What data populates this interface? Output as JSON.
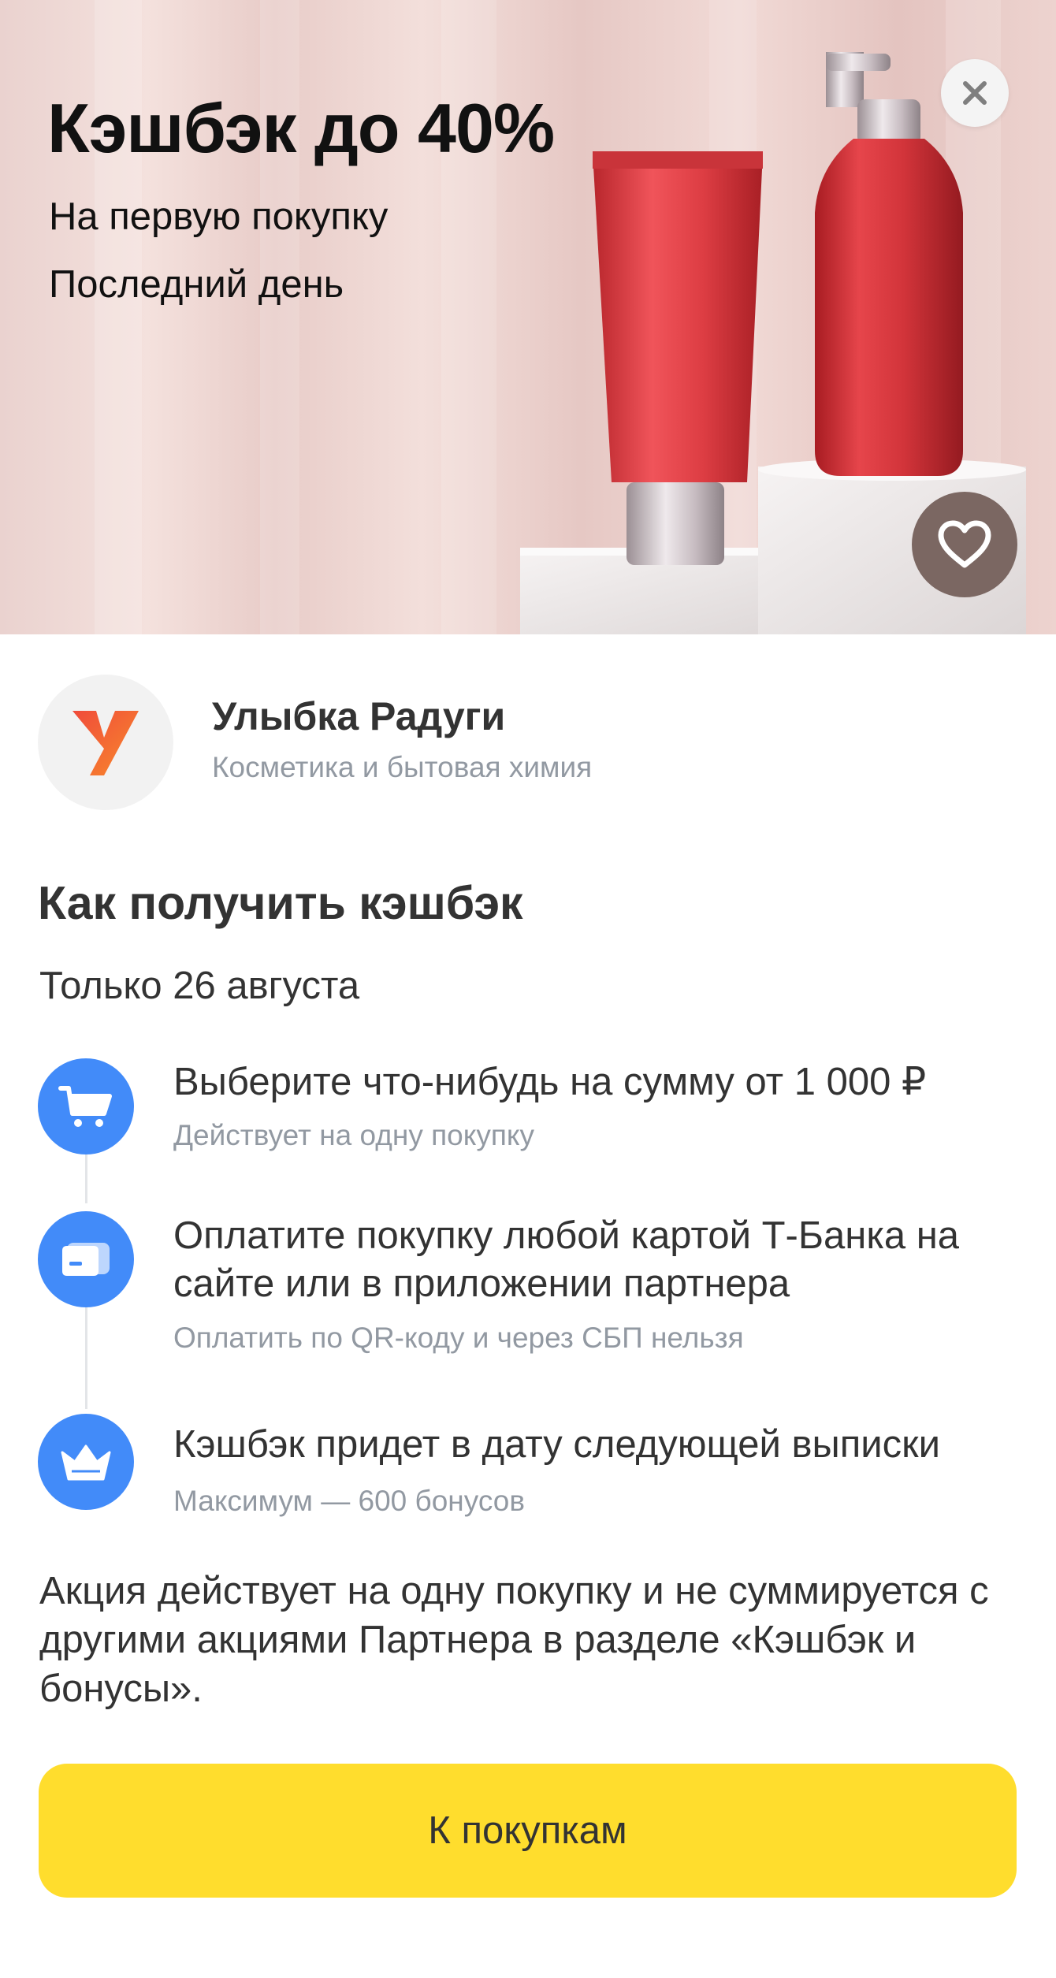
{
  "banner": {
    "title": "Кэшбэк до 40%",
    "subtitle": "На первую покупку",
    "deadline": "Последний день",
    "close_icon": "close-icon",
    "favorite_icon": "heart-icon"
  },
  "partner": {
    "name": "Улыбка Радуги",
    "category": "Косметика и бытовая химия",
    "logo_letter": "У"
  },
  "how_to": {
    "title": "Как получить кэшбэк",
    "date": "Только 26 августа",
    "steps": [
      {
        "icon": "cart-icon",
        "title": "Выберите что-нибудь на сумму от 1 000 ₽",
        "subtitle": "Действует на одну покупку"
      },
      {
        "icon": "card-icon",
        "title": "Оплатите покупку любой картой Т-Банка на сайте или в приложении партнера",
        "subtitle": "Оплатить по QR-коду и через СБП нельзя"
      },
      {
        "icon": "crown-icon",
        "title": "Кэшбэк придет в дату следующей выписки",
        "subtitle": "Максимум — 600 бонусов"
      }
    ]
  },
  "note": "Акция действует на одну покупку и не суммируется с другими акциями Партнера в разделе «Кэшбэк и бонусы».",
  "cta": {
    "label": "К покупкам"
  },
  "colors": {
    "accent_blue": "#428bf9",
    "button_yellow": "#ffdd2d",
    "text_primary": "#333333",
    "text_secondary": "#9299a2",
    "product_red": "#d8383d"
  }
}
